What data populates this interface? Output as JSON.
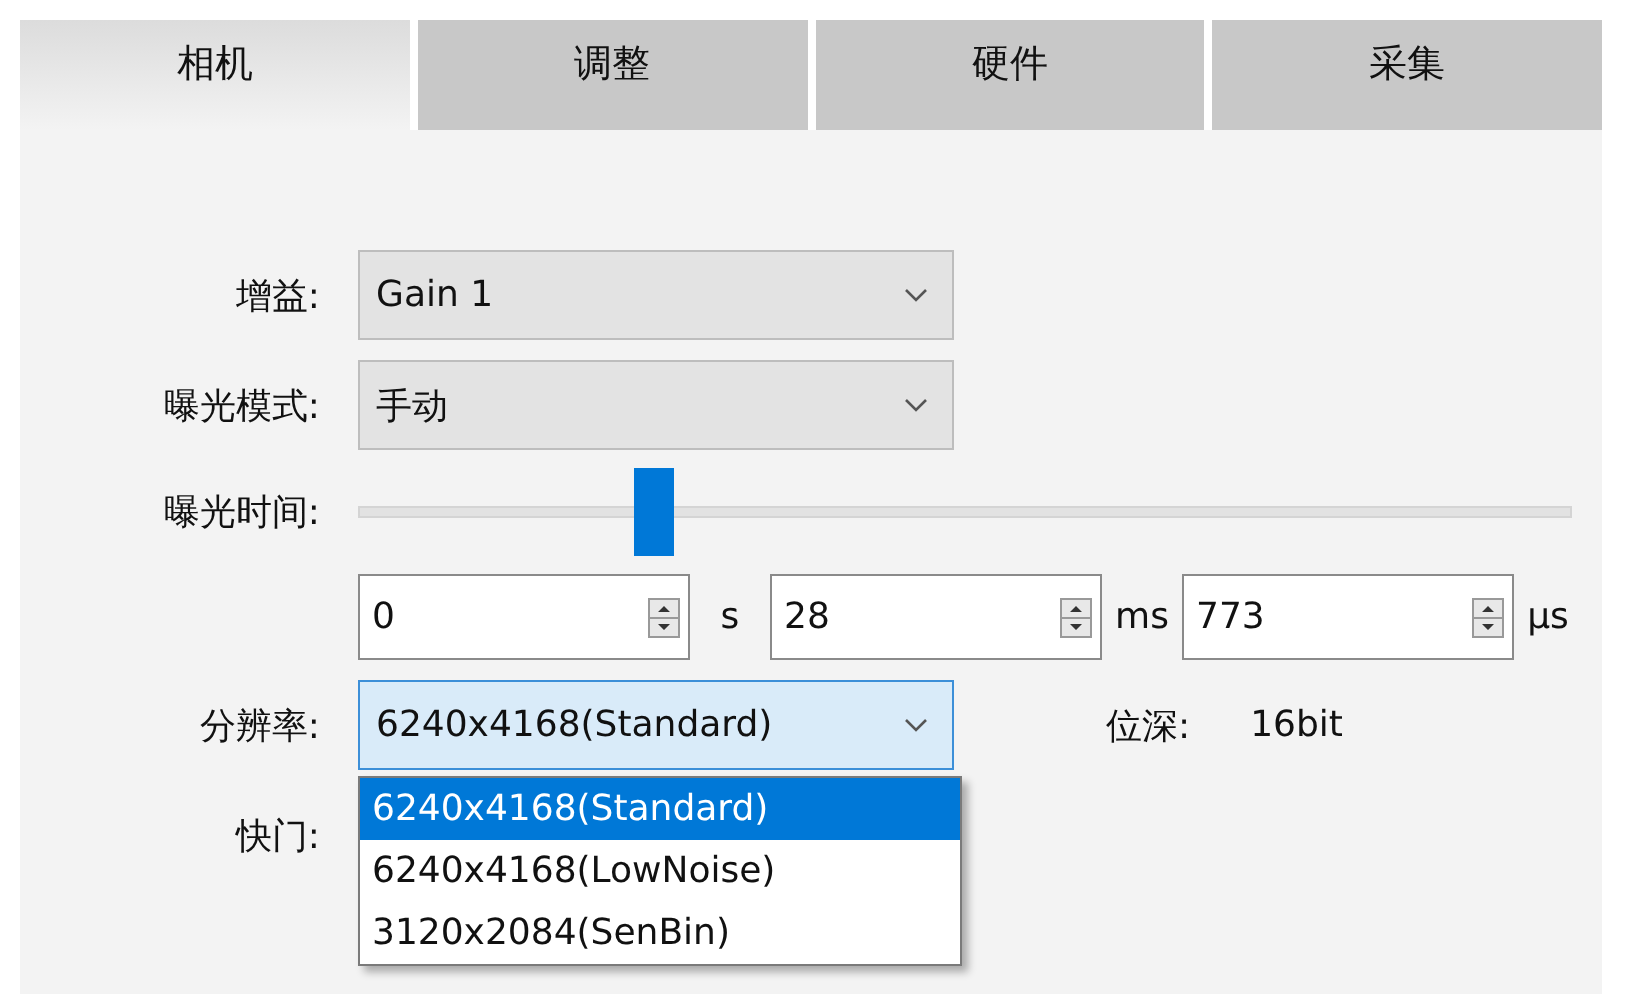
{
  "tabs": [
    {
      "label": "相机",
      "selected": true
    },
    {
      "label": "调整",
      "selected": false
    },
    {
      "label": "硬件",
      "selected": false
    },
    {
      "label": "采集",
      "selected": false
    }
  ],
  "gain": {
    "label": "增益:",
    "value": "Gain 1"
  },
  "exposure_mode": {
    "label": "曝光模式:",
    "value": "手动"
  },
  "exposure_time": {
    "label": "曝光时间:",
    "level": 0.244,
    "fields": [
      {
        "value": "0",
        "unit": "s"
      },
      {
        "value": "28",
        "unit": "ms"
      },
      {
        "value": "773",
        "unit": "µs"
      }
    ]
  },
  "resolution": {
    "label": "分辨率:",
    "value": "6240x4168(Standard)",
    "expanded": true,
    "options": [
      {
        "label": "6240x4168(Standard)",
        "selected": true
      },
      {
        "label": "6240x4168(LowNoise)",
        "selected": false
      },
      {
        "label": "3120x2084(SenBin)",
        "selected": false
      }
    ]
  },
  "bit_depth": {
    "label": "位深:",
    "value": "16bit"
  },
  "shutter": {
    "label": "快门:"
  }
}
